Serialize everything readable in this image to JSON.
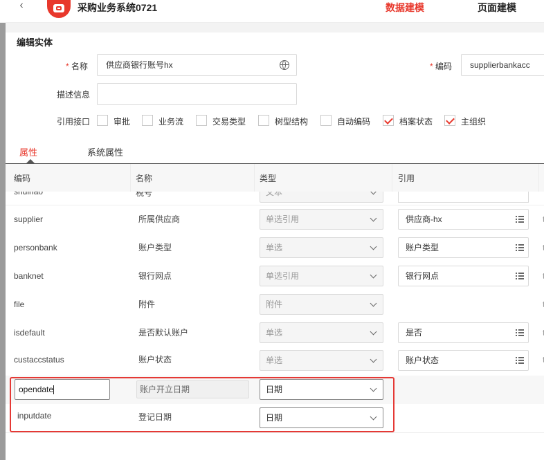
{
  "app": {
    "title": "采购业务系统0721",
    "back_icon": "chevron-left-icon"
  },
  "top_tabs": [
    {
      "label": "数据建模",
      "active": true
    },
    {
      "label": "页面建模",
      "active": false
    }
  ],
  "form": {
    "section_title": "编辑实体",
    "name_label": "名称",
    "name_value": "供应商银行账号hx",
    "code_label": "编码",
    "code_value": "supplierbankacc",
    "desc_label": "描述信息",
    "desc_value": "",
    "interface_label": "引用接口",
    "interfaces": [
      {
        "label": "审批",
        "checked": false
      },
      {
        "label": "业务流",
        "checked": false
      },
      {
        "label": "交易类型",
        "checked": false
      },
      {
        "label": "树型结构",
        "checked": false
      },
      {
        "label": "自动编码",
        "checked": false
      },
      {
        "label": "档案状态",
        "checked": true
      },
      {
        "label": "主组织",
        "checked": true
      }
    ]
  },
  "tabs": [
    {
      "label": "属性",
      "active": true
    },
    {
      "label": "系统属性",
      "active": false
    }
  ],
  "table": {
    "headers": [
      "编码",
      "名称",
      "类型",
      "引用"
    ],
    "partial_row": {
      "code": "shdinao",
      "name": "税号",
      "type": "文本"
    },
    "rows": [
      {
        "code": "supplier",
        "name": "所属供应商",
        "type": "单选引用",
        "ref": "供应商-hx"
      },
      {
        "code": "personbank",
        "name": "账户类型",
        "type": "单选",
        "ref": "账户类型"
      },
      {
        "code": "banknet",
        "name": "银行网点",
        "type": "单选引用",
        "ref": "银行网点"
      },
      {
        "code": "file",
        "name": "附件",
        "type": "附件",
        "ref": ""
      },
      {
        "code": "isdefault",
        "name": "是否默认账户",
        "type": "单选",
        "ref": "是否"
      },
      {
        "code": "custaccstatus",
        "name": "账户状态",
        "type": "单选",
        "ref": "账户状态"
      }
    ],
    "editing_rows": [
      {
        "code": "opendate",
        "name": "账户开立日期",
        "type": "日期"
      },
      {
        "code": "inputdate",
        "name": "登记日期",
        "type": "日期"
      }
    ],
    "trailing_glyph": "t"
  },
  "colors": {
    "accent": "#e8382c",
    "highlight_border": "#e53935"
  }
}
